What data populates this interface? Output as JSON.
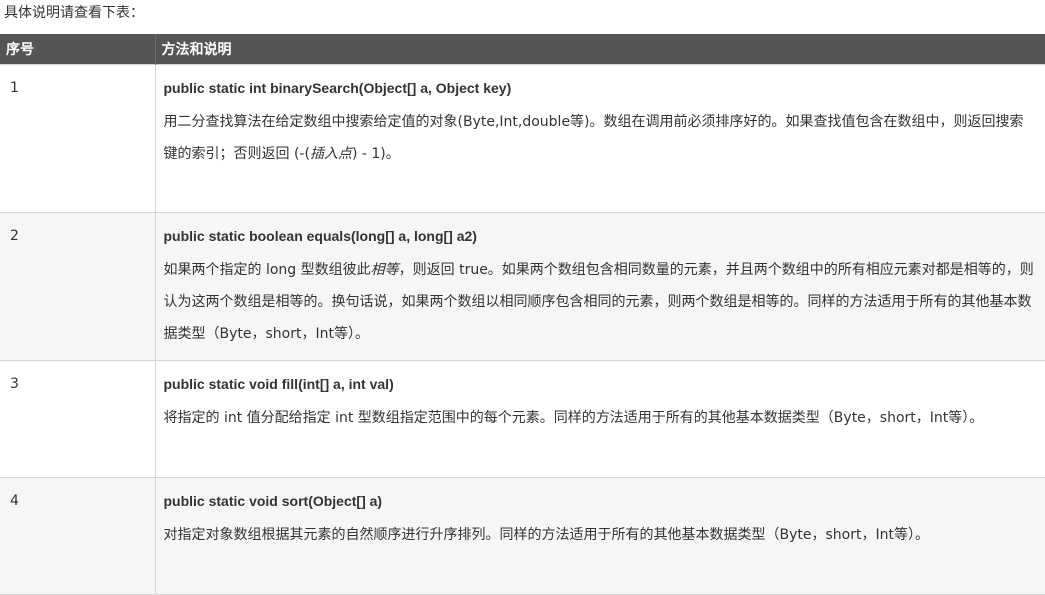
{
  "intro": "具体说明请查看下表：",
  "table": {
    "headers": [
      "序号",
      "方法和说明"
    ],
    "rows": [
      {
        "num": "1",
        "signature": "public static int binarySearch(Object[] a, Object key)",
        "desc_a": "用二分查找算法在给定数组中搜索给定值的对象(Byte,Int,double等)。数组在调用前必须排序好的。如果查找值包含在数组中，则返回搜索键的索引；否则返回 (-(",
        "desc_em": "插入点",
        "desc_b": ") - 1)。"
      },
      {
        "num": "2",
        "signature": "public static boolean equals(long[] a, long[] a2)",
        "desc_a": "如果两个指定的 long 型数组彼此",
        "desc_em": "相等",
        "desc_b": "，则返回 true。如果两个数组包含相同数量的元素，并且两个数组中的所有相应元素对都是相等的，则认为这两个数组是相等的。换句话说，如果两个数组以相同顺序包含相同的元素，则两个数组是相等的。同样的方法适用于所有的其他基本数据类型（Byte，short，Int等）。"
      },
      {
        "num": "3",
        "signature": "public static void fill(int[] a, int val)",
        "desc": "将指定的 int 值分配给指定 int 型数组指定范围中的每个元素。同样的方法适用于所有的其他基本数据类型（Byte，short，Int等）。"
      },
      {
        "num": "4",
        "signature": "public static void sort(Object[] a)",
        "desc": "对指定对象数组根据其元素的自然顺序进行升序排列。同样的方法适用于所有的其他基本数据类型（Byte，short，Int等）。"
      }
    ]
  },
  "colors": {
    "header_bg": "#555555",
    "header_text": "#ffffff",
    "row_alt_bg": "#f6f6f6",
    "border": "#d4d4d4",
    "text": "#333333"
  }
}
